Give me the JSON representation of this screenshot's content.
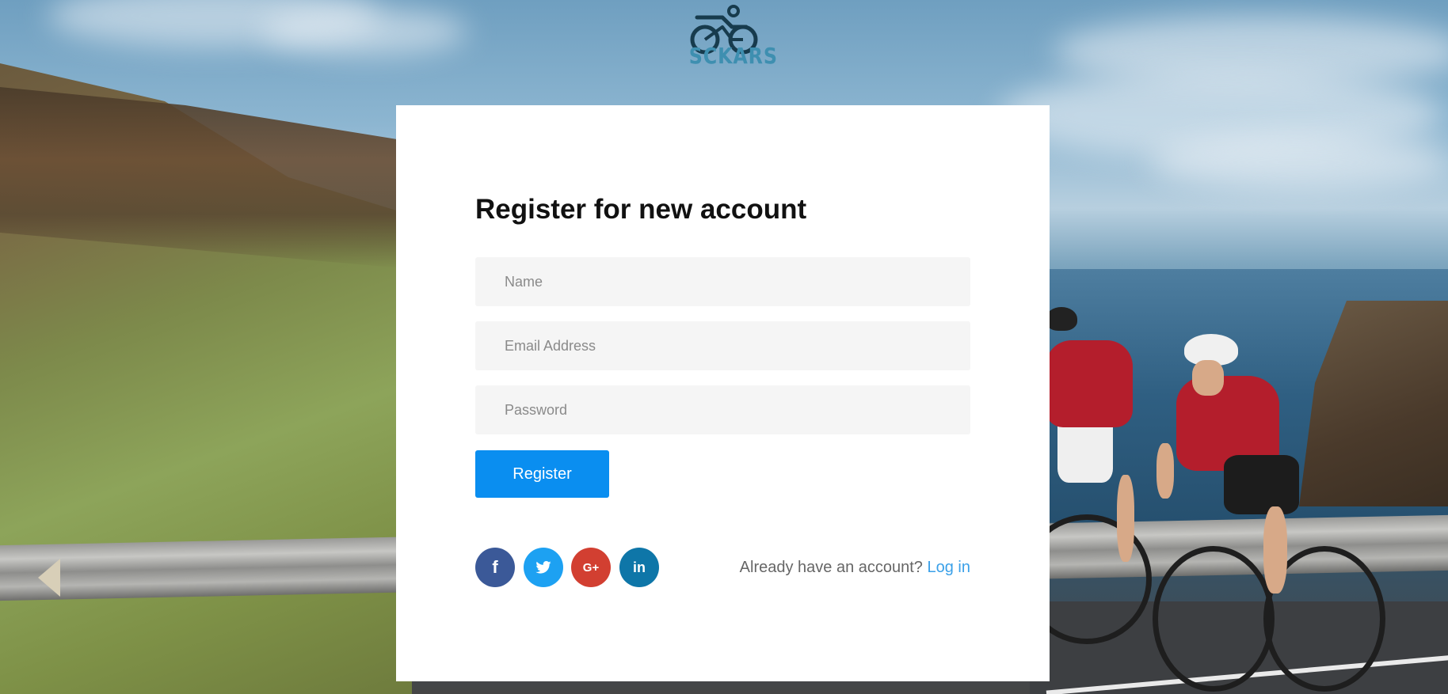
{
  "brand": {
    "logo_text": "SCKARS"
  },
  "form": {
    "title": "Register for new account",
    "name_placeholder": "Name",
    "email_placeholder": "Email Address",
    "password_placeholder": "Password",
    "register_label": "Register"
  },
  "social": {
    "facebook_glyph": "f",
    "google_glyph": "G+",
    "linkedin_glyph": "in",
    "icons": [
      "facebook-icon",
      "twitter-icon",
      "google-plus-icon",
      "linkedin-icon"
    ]
  },
  "login": {
    "prompt": "Already have an account?",
    "link_label": "Log in"
  },
  "colors": {
    "primary": "#0a8ef0",
    "link": "#3aa0e8",
    "facebook": "#3b5998",
    "twitter": "#1da1f2",
    "google_plus": "#d23f31",
    "linkedin": "#0e76a8"
  }
}
